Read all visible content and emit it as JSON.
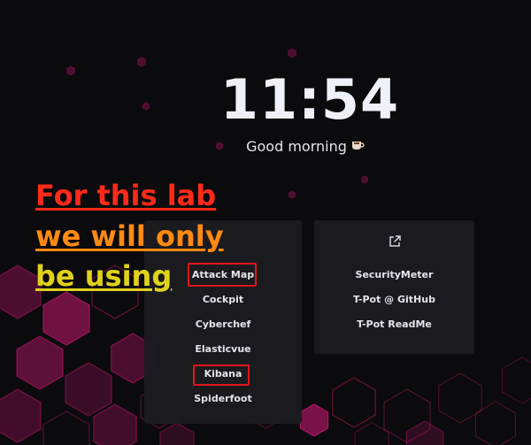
{
  "clock": "11:54",
  "greeting": "Good morning",
  "greeting_icon": "coffee-cup-icon",
  "annotation": {
    "lines": [
      "For this lab",
      "we will only",
      "be using"
    ],
    "colors": [
      "#ff2a1a",
      "#ff8a12",
      "#e0d21a"
    ]
  },
  "tools": [
    "Attack Map",
    "Cockpit",
    "Cyberchef",
    "Elasticvue",
    "Kibana",
    "Spiderfoot"
  ],
  "highlighted_tools": [
    "Attack Map",
    "Kibana"
  ],
  "links": {
    "icon": "external-link-icon",
    "items": [
      "SecurityMeter",
      "T-Pot @ GitHub",
      "T-Pot ReadMe"
    ]
  },
  "colors": {
    "background": "#0b0a0d",
    "card": "#1c1c20",
    "hexagon": "#c2186e",
    "highlight": "#e0151c"
  }
}
